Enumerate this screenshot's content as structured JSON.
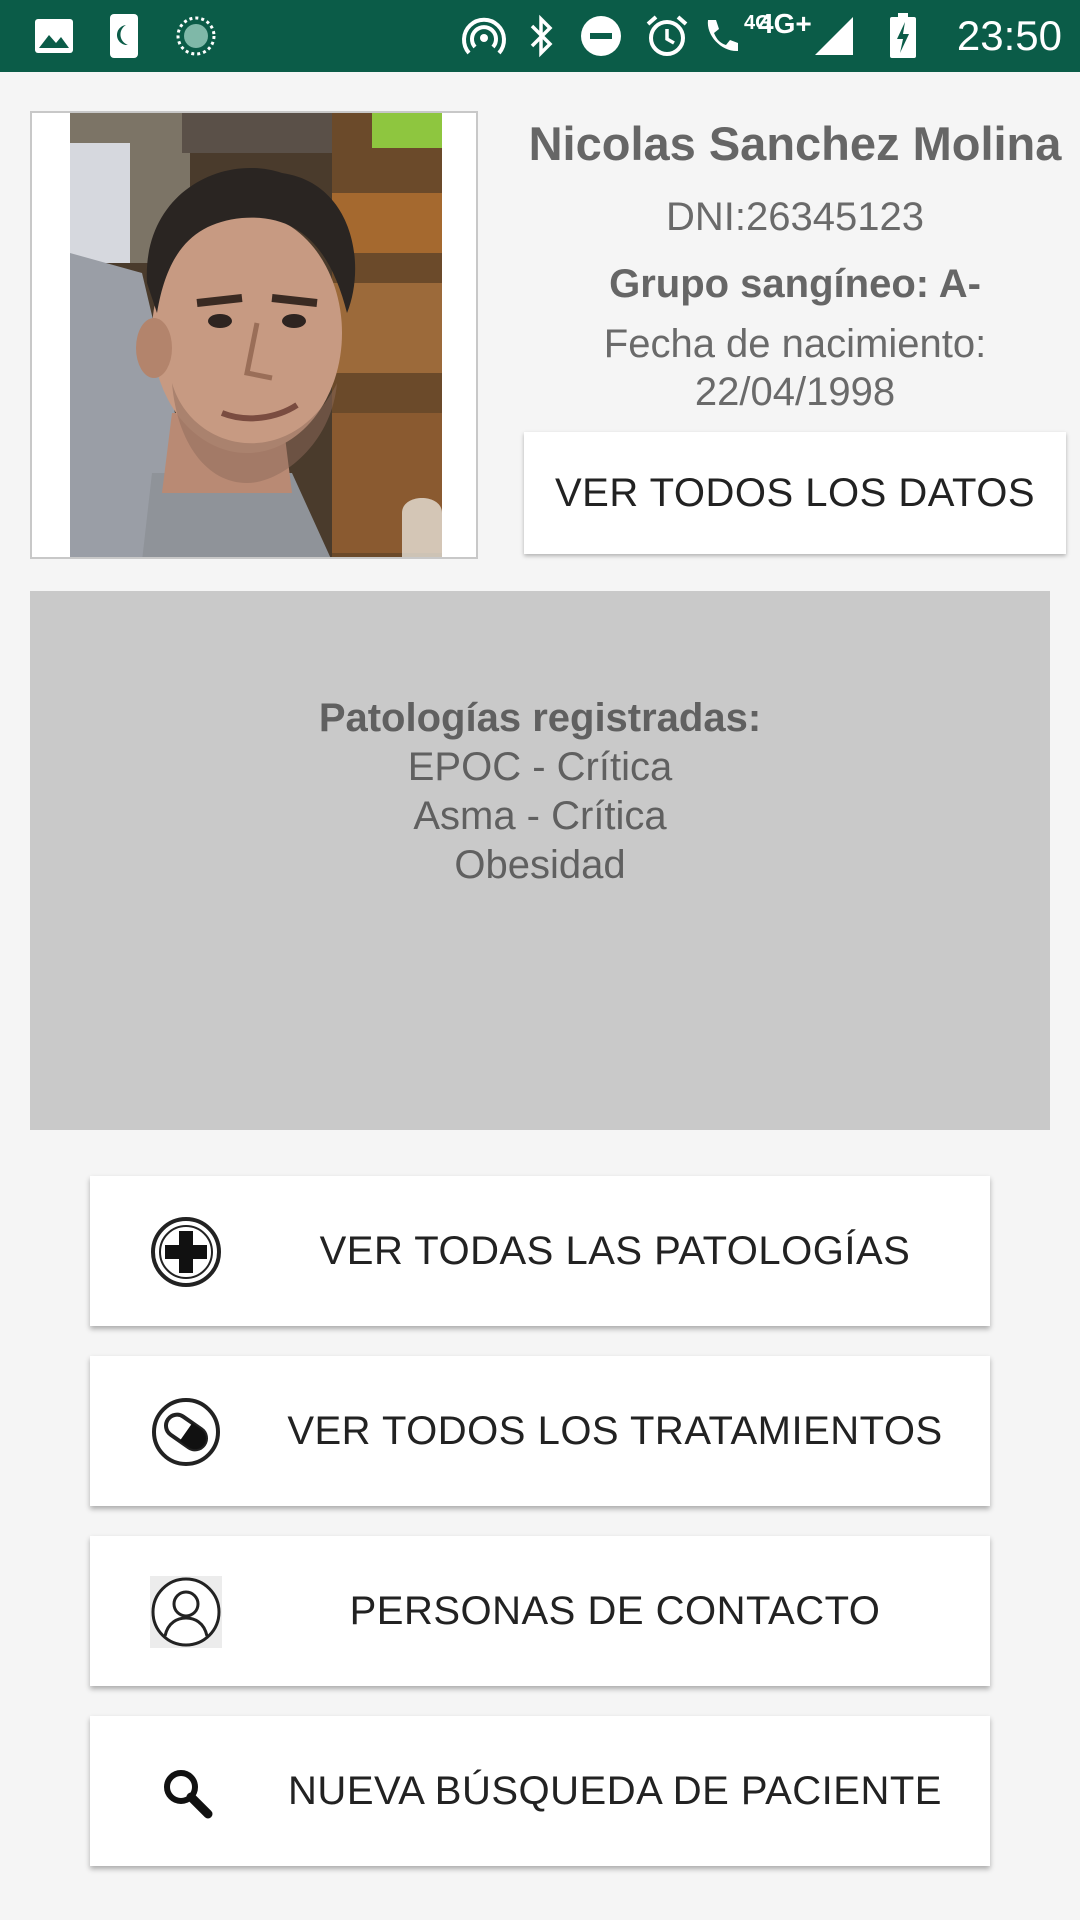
{
  "status_bar": {
    "time": "23:50",
    "network_4g_small": "4G",
    "network_4g_plus": "4G+",
    "icons": [
      "image-icon",
      "night-mode-icon",
      "loading-icon",
      "hotspot-icon",
      "bluetooth-icon",
      "do-not-disturb-icon",
      "alarm-icon",
      "wifi-calling-icon",
      "signal-icon",
      "battery-charging-icon"
    ]
  },
  "patient": {
    "name": "Nicolas Sanchez Molina",
    "dni": "DNI:26345123",
    "blood_group": "Grupo sangíneo: A-",
    "birth_label": "Fecha de nacimiento:",
    "birth_date": "22/04/1998"
  },
  "view_all_data_label": "VER TODOS LOS DATOS",
  "pathologies": {
    "title": "Patologías registradas:",
    "items": [
      "EPOC - Crítica",
      "Asma - Crítica",
      "Obesidad"
    ]
  },
  "actions": [
    {
      "label": "VER TODAS LAS PATOLOGÍAS",
      "icon": "medical-cross-icon"
    },
    {
      "label": "VER TODOS LOS TRATAMIENTOS",
      "icon": "pill-icon"
    },
    {
      "label": "PERSONAS DE CONTACTO",
      "icon": "contact-person-icon"
    },
    {
      "label": "NUEVA BÚSQUEDA DE PACIENTE",
      "icon": "search-icon"
    }
  ],
  "colors": {
    "status_bar": "#0b5c48",
    "background": "#f5f5f5",
    "pathology_box": "#c9c9c9"
  }
}
